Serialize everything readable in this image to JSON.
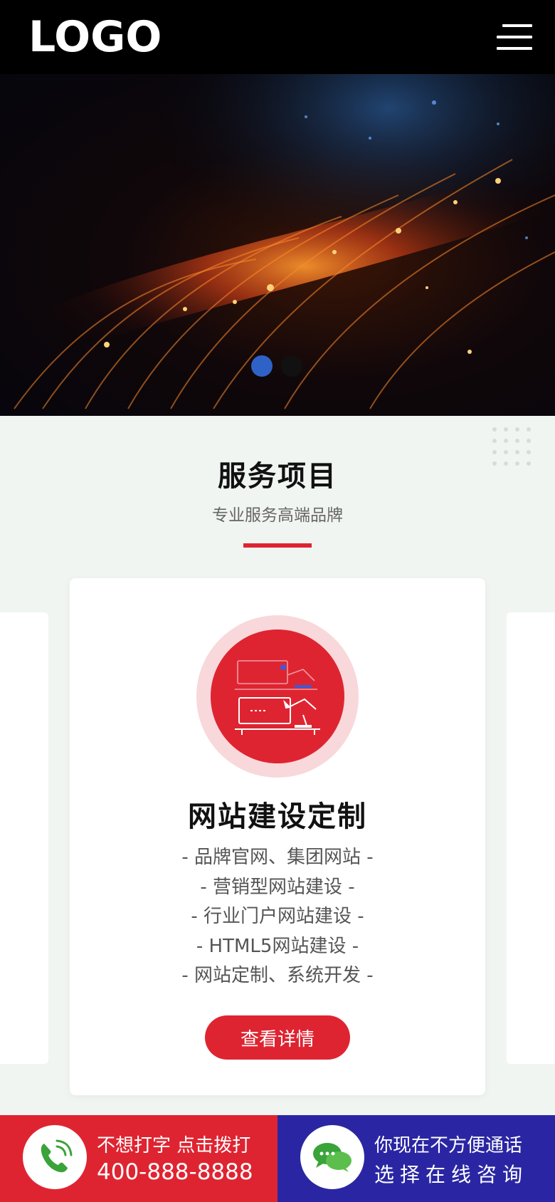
{
  "header": {
    "logo_text": "LOGO",
    "menu_icon": "hamburger-menu-icon"
  },
  "banner": {
    "slide_count": 2,
    "active_slide": 1,
    "colors": {
      "active_dot": "#2f62c7",
      "inactive_dot": "#111111"
    }
  },
  "services": {
    "title": "服务项目",
    "subtitle": "专业服务高端品牌",
    "accent_color": "#df2431",
    "card": {
      "icon": "website-design-icon",
      "title": "网站建设定制",
      "lines": [
        "- 品牌官网、集团网站 -",
        "- 营销型网站建设 -",
        "- 行业门户网站建设 -",
        "- HTML5网站建设 -",
        "- 网站定制、系统开发 -"
      ],
      "button_label": "查看详情"
    }
  },
  "bottom_bar": {
    "call": {
      "icon": "phone-icon",
      "line1": "不想打字 点击拨打",
      "line2": "400-888-8888",
      "color": "#df2431"
    },
    "chat": {
      "icon": "chat-bubble-icon",
      "line1": "你现在不方便通话",
      "line2": "选择在线咨询",
      "color": "#2a26a3"
    }
  }
}
